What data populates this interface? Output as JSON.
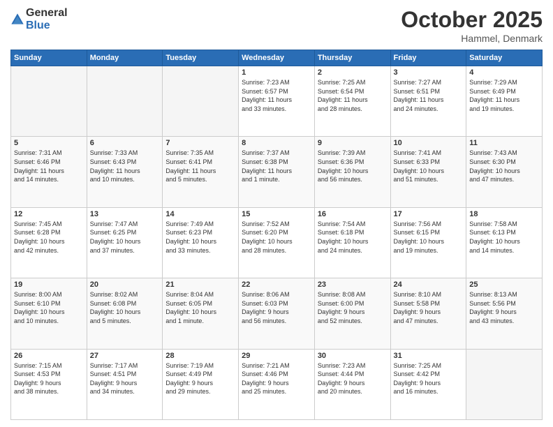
{
  "header": {
    "logo_general": "General",
    "logo_blue": "Blue",
    "month_title": "October 2025",
    "location": "Hammel, Denmark"
  },
  "days_of_week": [
    "Sunday",
    "Monday",
    "Tuesday",
    "Wednesday",
    "Thursday",
    "Friday",
    "Saturday"
  ],
  "weeks": [
    [
      {
        "day": "",
        "info": ""
      },
      {
        "day": "",
        "info": ""
      },
      {
        "day": "",
        "info": ""
      },
      {
        "day": "1",
        "info": "Sunrise: 7:23 AM\nSunset: 6:57 PM\nDaylight: 11 hours\nand 33 minutes."
      },
      {
        "day": "2",
        "info": "Sunrise: 7:25 AM\nSunset: 6:54 PM\nDaylight: 11 hours\nand 28 minutes."
      },
      {
        "day": "3",
        "info": "Sunrise: 7:27 AM\nSunset: 6:51 PM\nDaylight: 11 hours\nand 24 minutes."
      },
      {
        "day": "4",
        "info": "Sunrise: 7:29 AM\nSunset: 6:49 PM\nDaylight: 11 hours\nand 19 minutes."
      }
    ],
    [
      {
        "day": "5",
        "info": "Sunrise: 7:31 AM\nSunset: 6:46 PM\nDaylight: 11 hours\nand 14 minutes."
      },
      {
        "day": "6",
        "info": "Sunrise: 7:33 AM\nSunset: 6:43 PM\nDaylight: 11 hours\nand 10 minutes."
      },
      {
        "day": "7",
        "info": "Sunrise: 7:35 AM\nSunset: 6:41 PM\nDaylight: 11 hours\nand 5 minutes."
      },
      {
        "day": "8",
        "info": "Sunrise: 7:37 AM\nSunset: 6:38 PM\nDaylight: 11 hours\nand 1 minute."
      },
      {
        "day": "9",
        "info": "Sunrise: 7:39 AM\nSunset: 6:36 PM\nDaylight: 10 hours\nand 56 minutes."
      },
      {
        "day": "10",
        "info": "Sunrise: 7:41 AM\nSunset: 6:33 PM\nDaylight: 10 hours\nand 51 minutes."
      },
      {
        "day": "11",
        "info": "Sunrise: 7:43 AM\nSunset: 6:30 PM\nDaylight: 10 hours\nand 47 minutes."
      }
    ],
    [
      {
        "day": "12",
        "info": "Sunrise: 7:45 AM\nSunset: 6:28 PM\nDaylight: 10 hours\nand 42 minutes."
      },
      {
        "day": "13",
        "info": "Sunrise: 7:47 AM\nSunset: 6:25 PM\nDaylight: 10 hours\nand 37 minutes."
      },
      {
        "day": "14",
        "info": "Sunrise: 7:49 AM\nSunset: 6:23 PM\nDaylight: 10 hours\nand 33 minutes."
      },
      {
        "day": "15",
        "info": "Sunrise: 7:52 AM\nSunset: 6:20 PM\nDaylight: 10 hours\nand 28 minutes."
      },
      {
        "day": "16",
        "info": "Sunrise: 7:54 AM\nSunset: 6:18 PM\nDaylight: 10 hours\nand 24 minutes."
      },
      {
        "day": "17",
        "info": "Sunrise: 7:56 AM\nSunset: 6:15 PM\nDaylight: 10 hours\nand 19 minutes."
      },
      {
        "day": "18",
        "info": "Sunrise: 7:58 AM\nSunset: 6:13 PM\nDaylight: 10 hours\nand 14 minutes."
      }
    ],
    [
      {
        "day": "19",
        "info": "Sunrise: 8:00 AM\nSunset: 6:10 PM\nDaylight: 10 hours\nand 10 minutes."
      },
      {
        "day": "20",
        "info": "Sunrise: 8:02 AM\nSunset: 6:08 PM\nDaylight: 10 hours\nand 5 minutes."
      },
      {
        "day": "21",
        "info": "Sunrise: 8:04 AM\nSunset: 6:05 PM\nDaylight: 10 hours\nand 1 minute."
      },
      {
        "day": "22",
        "info": "Sunrise: 8:06 AM\nSunset: 6:03 PM\nDaylight: 9 hours\nand 56 minutes."
      },
      {
        "day": "23",
        "info": "Sunrise: 8:08 AM\nSunset: 6:00 PM\nDaylight: 9 hours\nand 52 minutes."
      },
      {
        "day": "24",
        "info": "Sunrise: 8:10 AM\nSunset: 5:58 PM\nDaylight: 9 hours\nand 47 minutes."
      },
      {
        "day": "25",
        "info": "Sunrise: 8:13 AM\nSunset: 5:56 PM\nDaylight: 9 hours\nand 43 minutes."
      }
    ],
    [
      {
        "day": "26",
        "info": "Sunrise: 7:15 AM\nSunset: 4:53 PM\nDaylight: 9 hours\nand 38 minutes."
      },
      {
        "day": "27",
        "info": "Sunrise: 7:17 AM\nSunset: 4:51 PM\nDaylight: 9 hours\nand 34 minutes."
      },
      {
        "day": "28",
        "info": "Sunrise: 7:19 AM\nSunset: 4:49 PM\nDaylight: 9 hours\nand 29 minutes."
      },
      {
        "day": "29",
        "info": "Sunrise: 7:21 AM\nSunset: 4:46 PM\nDaylight: 9 hours\nand 25 minutes."
      },
      {
        "day": "30",
        "info": "Sunrise: 7:23 AM\nSunset: 4:44 PM\nDaylight: 9 hours\nand 20 minutes."
      },
      {
        "day": "31",
        "info": "Sunrise: 7:25 AM\nSunset: 4:42 PM\nDaylight: 9 hours\nand 16 minutes."
      },
      {
        "day": "",
        "info": ""
      }
    ]
  ]
}
